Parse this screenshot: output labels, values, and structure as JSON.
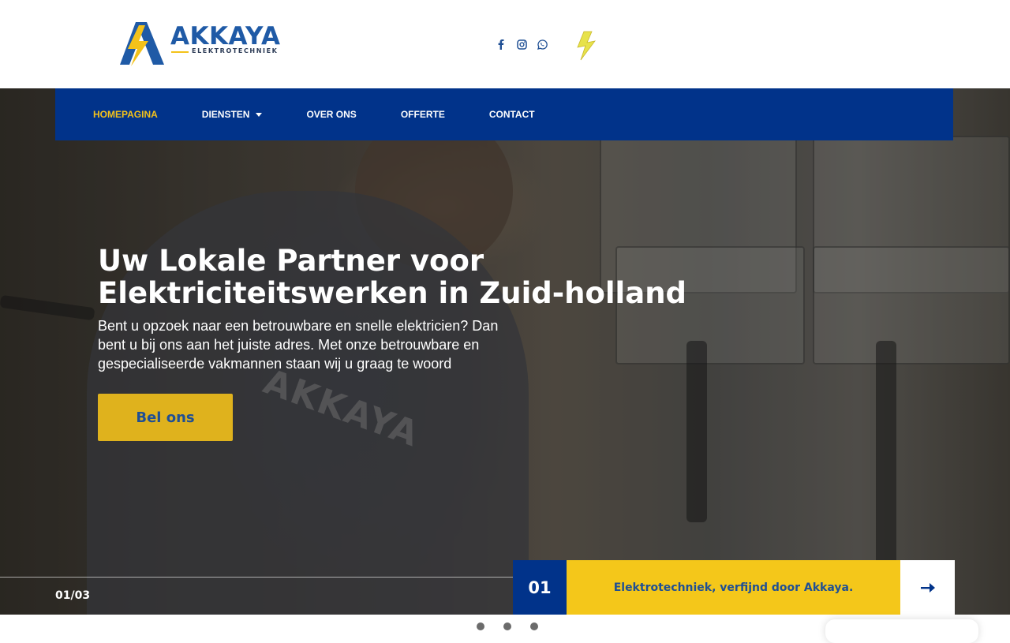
{
  "brand": {
    "name": "AKKAYA",
    "tagline": "ELEKTROTECHNIEK",
    "colors": {
      "primary": "#01338a",
      "accent": "#f4c71a"
    }
  },
  "socials": [
    {
      "icon": "facebook-icon"
    },
    {
      "icon": "instagram-icon"
    },
    {
      "icon": "whatsapp-icon"
    }
  ],
  "nav": {
    "items": [
      {
        "label": "HOMEPAGINA",
        "active": true
      },
      {
        "label": "DIENSTEN",
        "has_dropdown": true
      },
      {
        "label": "OVER ONS"
      },
      {
        "label": "OFFERTE"
      },
      {
        "label": "CONTACT"
      }
    ]
  },
  "hero": {
    "title_line1": "Uw Lokale Partner voor",
    "title_line2": "Elektriciteitswerken in Zuid-holland",
    "text": "Bent u opzoek naar een betrouwbare en snelle elektricien? Dan bent u bij ons aan het juiste adres. Met onze betrouwbare en gespecialiseerde vakmannen staan wij u graag te woord",
    "cta_label": "Bel ons",
    "image_print": "AKKAYA"
  },
  "slider": {
    "counter": "01/03",
    "number": "01",
    "caption": "Elektrotechniek, verfijnd door Akkaya.",
    "next_icon": "arrow-right-icon",
    "dots": 3
  }
}
